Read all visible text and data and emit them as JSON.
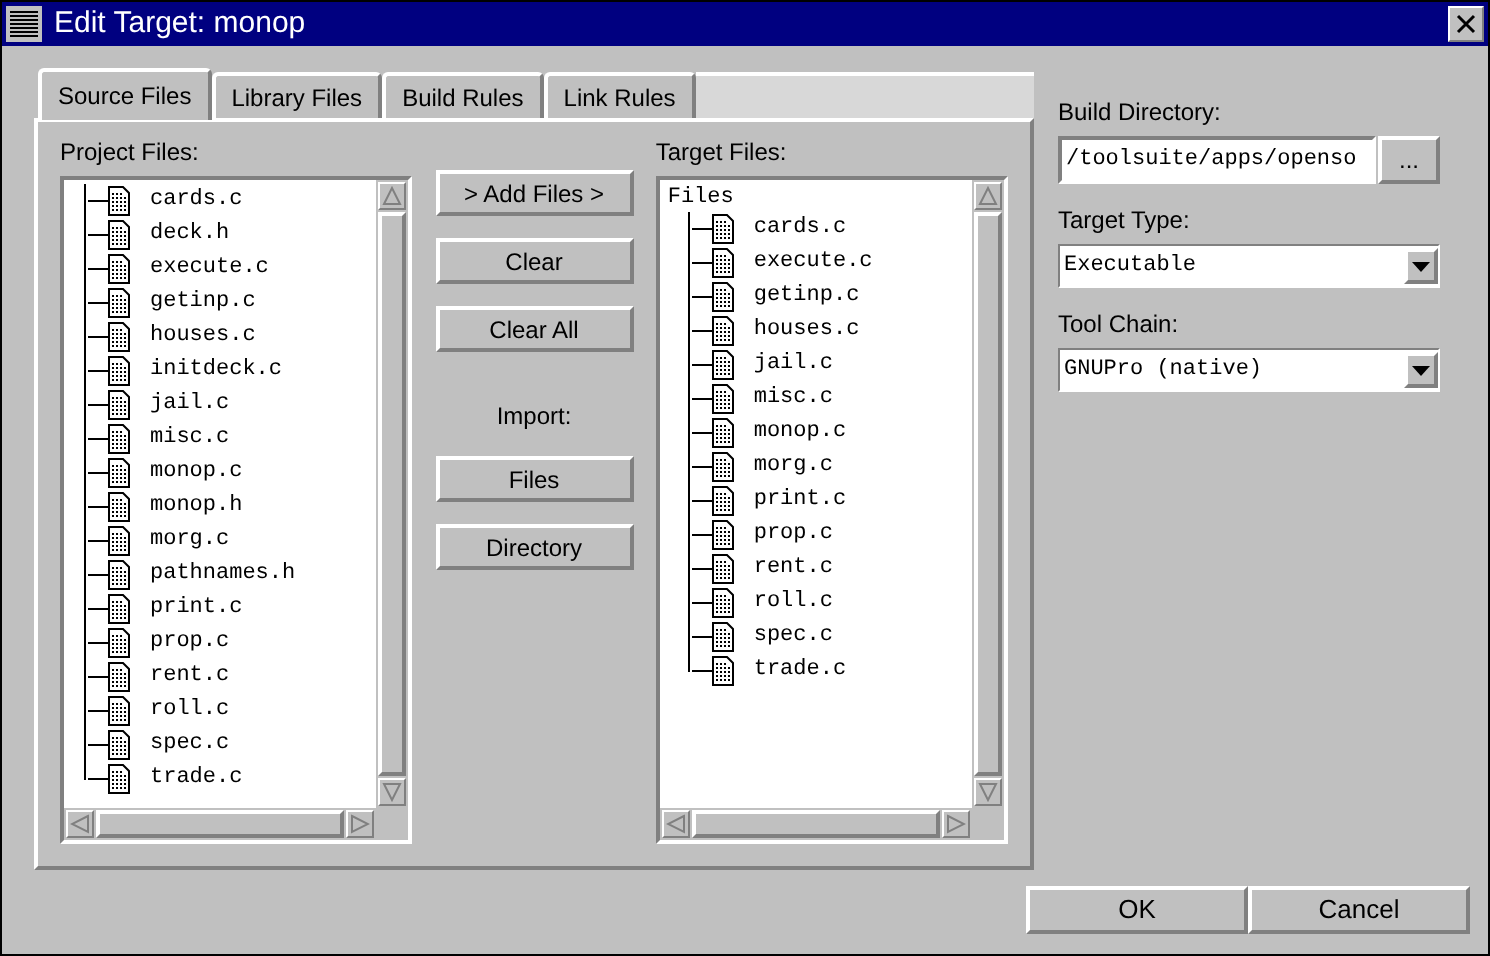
{
  "window": {
    "title": "Edit Target: monop"
  },
  "tabs": [
    {
      "label": "Source Files",
      "selected": true
    },
    {
      "label": "Library Files",
      "selected": false
    },
    {
      "label": "Build Rules",
      "selected": false
    },
    {
      "label": "Link Rules",
      "selected": false
    }
  ],
  "project_files": {
    "label": "Project Files:",
    "items": [
      "cards.c",
      "deck.h",
      "execute.c",
      "getinp.c",
      "houses.c",
      "initdeck.c",
      "jail.c",
      "misc.c",
      "monop.c",
      "monop.h",
      "morg.c",
      "pathnames.h",
      "print.c",
      "prop.c",
      "rent.c",
      "roll.c",
      "spec.c",
      "trade.c"
    ]
  },
  "actions": {
    "buttons": [
      "> Add Files >",
      "Clear",
      "Clear All"
    ],
    "import_label": "Import:",
    "import_buttons": [
      "Files",
      "Directory"
    ]
  },
  "target_files": {
    "label": "Target Files:",
    "root": "Files",
    "children": [
      "cards.c",
      "execute.c",
      "getinp.c",
      "houses.c",
      "jail.c",
      "misc.c",
      "monop.c",
      "morg.c",
      "print.c",
      "prop.c",
      "rent.c",
      "roll.c",
      "spec.c",
      "trade.c"
    ]
  },
  "build_directory": {
    "label": "Build Directory:",
    "value": "/toolsuite/apps/openso",
    "browse": "..."
  },
  "target_type": {
    "label": "Target Type:",
    "value": "Executable"
  },
  "tool_chain": {
    "label": "Tool Chain:",
    "value": "GNUPro (native)"
  },
  "footer_buttons": [
    "OK",
    "Cancel"
  ]
}
